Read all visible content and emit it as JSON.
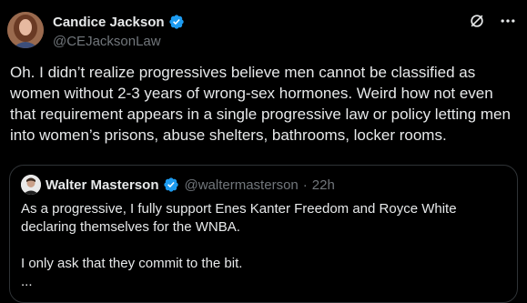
{
  "author": {
    "display_name": "Candice Jackson",
    "handle": "@CEJacksonLaw",
    "verified_color": "#1d9bf0",
    "avatar_icon": "profile-photo"
  },
  "top_icons": [
    "grok-icon",
    "more-icon"
  ],
  "tweet": {
    "text": "Oh. I didn’t realize progressives believe men cannot be classified as women without 2-3 years of wrong-sex hormones. Weird how not even that requirement appears in a single progressive law or policy letting men into women’s prisons, abuse shelters, bathrooms, locker rooms."
  },
  "quoted": {
    "display_name": "Walter Masterson",
    "handle": "@waltermasterson",
    "separator": "·",
    "time": "22h",
    "text": "As a progressive, I fully support Enes Kanter Freedom and Royce White declaring themselves for the WNBA.\n\nI only ask that they commit to the bit.\n..."
  },
  "colors": {
    "background": "#000000",
    "text": "#e7e9ea",
    "muted": "#71767b",
    "border": "#2f3336",
    "verified": "#1d9bf0"
  }
}
